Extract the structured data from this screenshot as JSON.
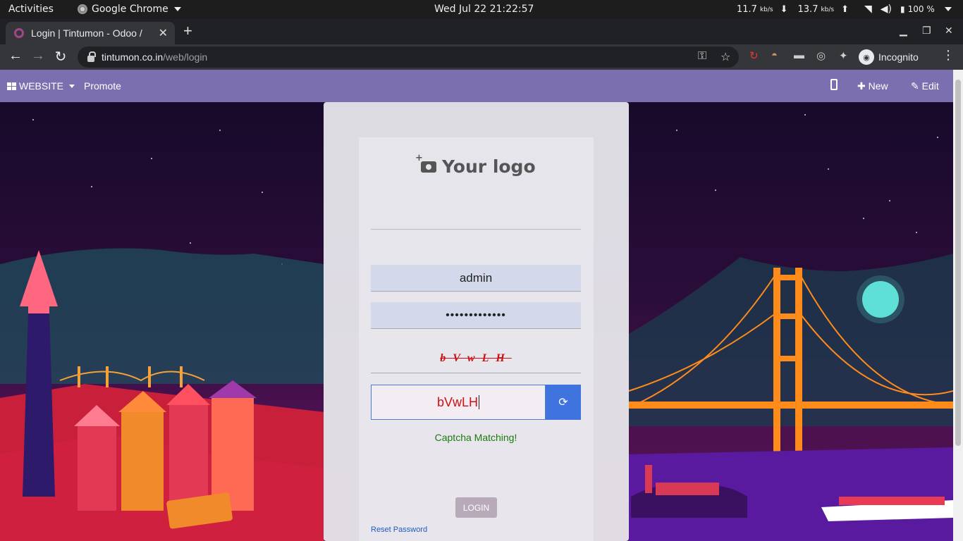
{
  "system_bar": {
    "activities": "Activities",
    "app_name": "Google Chrome",
    "clock": "Wed Jul 22  21:22:57",
    "net_down_value": "11.7",
    "net_down_unit": "kb/s",
    "net_up_value": "13.7",
    "net_up_unit": "kb/s",
    "battery": "100 %"
  },
  "browser": {
    "tab_title": "Login | Tintumon - Odoo /",
    "url_host": "tintumon.co.in",
    "url_path": "/web/login",
    "profile_label": "Incognito"
  },
  "editor_bar": {
    "website_label": "WEBSITE",
    "promote_label": "Promote",
    "new_label": "New",
    "edit_label": "Edit"
  },
  "login": {
    "logo_text": "Your logo",
    "username_value": "admin",
    "password_value": "•••••••••••••",
    "captcha_text": "bVwLH",
    "captcha_input_value": "bVwLH",
    "captcha_status": "Captcha Matching!",
    "login_button": "LOGIN",
    "reset_link": "Reset Password"
  },
  "colors": {
    "editor_bar": "#7b6fb0",
    "captcha_red": "#cc1111",
    "refresh_blue": "#3f74df",
    "success_green": "#1a7a10"
  }
}
